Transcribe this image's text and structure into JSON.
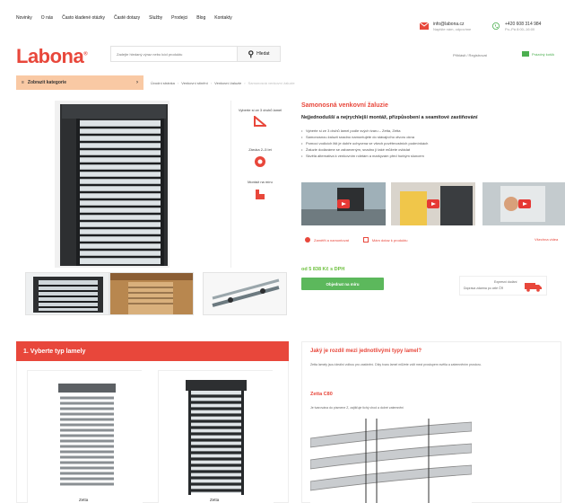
{
  "topnav": {
    "links": [
      "Novinky",
      "O nás",
      "Často kladené otázky",
      "Časté dotazy",
      "Služby",
      "Prodejci",
      "Blog",
      "Kontakty"
    ],
    "email": {
      "value": "info@labona.cz",
      "sub": "Napište nám, odpovíme"
    },
    "phone": {
      "value": "+420 608 314 984",
      "sub": "Po–Pá 8:00–16:00"
    }
  },
  "header": {
    "logo": "Labona",
    "search_placeholder": "Zadejte hledaný výraz nebo kód produktu",
    "search_button": "Hledat",
    "account": "Přihlásit / Registrovat",
    "cart": "Prázdný košík"
  },
  "nav": {
    "category_button": "Zobrazit kategorie",
    "breadcrumb": [
      "Úvodní stránka",
      "Venkovní stínění",
      "Venkovní žaluzie",
      "Samonosná venkovní žaluzie"
    ]
  },
  "product": {
    "title": "Samonosná venkovní žaluzie",
    "subtitle": "Nejjednodušší a nejrychlejší montáž, přizpůsobení a seamitové zastiňování",
    "bullets": [
      "Vyberte si ze 3 druhů lamel podle svých tvaru – Zetta, Zetta",
      "Samonosnou žaluzii snadno namontujete do stávajícího otvoru okna",
      "Pomocí vodicích lišt je dobře uchycena ve všech povětrnostních podmínkách",
      "Žaluzie dodáváme se zabarveným, snadno ji také můžete ovládat",
      "Skvělá alternativa k venkovním roletám a markýzám před horkým sluncem"
    ],
    "features": [
      {
        "label": "Vyberte si ze 3 druhů lamel",
        "icon": "triangle-icon"
      },
      {
        "label": "Záruka 2–5 let",
        "icon": "shield-icon"
      },
      {
        "label": "Montáž na míru",
        "icon": "house-icon"
      }
    ],
    "actions": {
      "measure": "Zaměřit a namontovat",
      "ask": "Mám dotaz k produktu",
      "all_videos": "Všechna videa"
    },
    "price": "od 5 838 Kč s DPH",
    "cta": "Objednat na míru",
    "delivery": {
      "line1": "Expresní dodání",
      "line2": "Doprava zdarma po celé ČR"
    }
  },
  "section1": {
    "title": "1. Vyberte typ lamely",
    "lamels": [
      "Zetta",
      "Zetta"
    ]
  },
  "info": {
    "heading": "Jaký je rozdíl mezi jednotlivými typy lamel?",
    "text": "Zetta lamely jsou ideální volbou pro zastínění. Díky tvaru lamel můžete volit mezi prostupem světla a zatemněním prostoru.",
    "subheading": "Zetta C80",
    "subtext": "Je tvarována do písmene Z, zajišťuje tichý chod a dobré zatemnění"
  },
  "colors": {
    "accent": "#e8473b",
    "green": "#5cb85c",
    "catbar": "#f9c9a4"
  }
}
